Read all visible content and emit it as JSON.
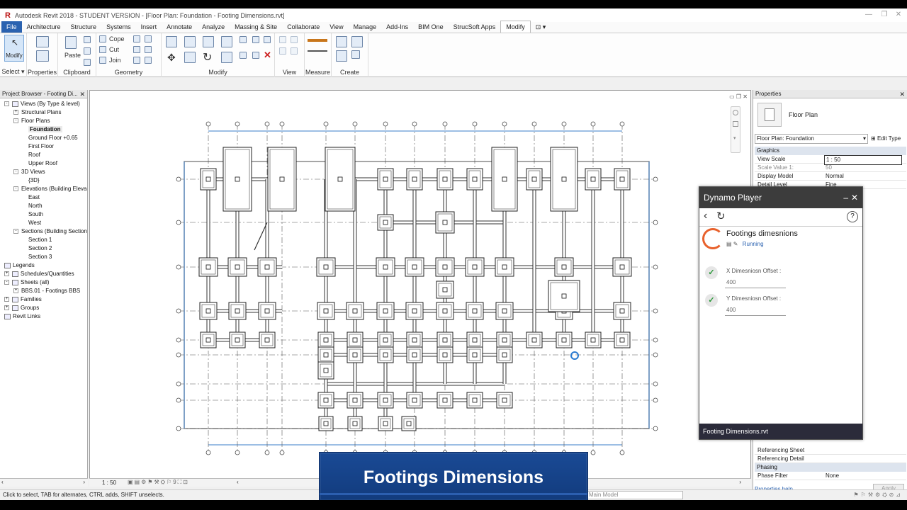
{
  "window": {
    "title": "Autodesk Revit 2018 - STUDENT VERSION - [Floor Plan: Foundation - Footing Dimensions.rvt]"
  },
  "ribbon": {
    "tabs": [
      "File",
      "Architecture",
      "Structure",
      "Systems",
      "Insert",
      "Annotate",
      "Analyze",
      "Massing & Site",
      "Collaborate",
      "View",
      "Manage",
      "Add-Ins",
      "BIM One",
      "StrucSoft Apps",
      "Modify"
    ],
    "active_tab": "Modify",
    "modify_label": "Modify",
    "panels": {
      "select": "Select",
      "properties": "Properties",
      "clipboard": "Clipboard",
      "paste": "Paste",
      "geometry": "Geometry",
      "modify": "Modify",
      "view": "View",
      "measure": "Measure",
      "create": "Create"
    },
    "geometry_items": {
      "cope": "Cope",
      "cut": "Cut",
      "join": "Join"
    }
  },
  "project_browser": {
    "title": "Project Browser - Footing Di...",
    "nodes": [
      {
        "label": "Views (By Type & level)",
        "toggle": "-",
        "level": 0,
        "icon": true
      },
      {
        "label": "Structural Plans",
        "toggle": "+",
        "level": 1
      },
      {
        "label": "Floor Plans",
        "toggle": "-",
        "level": 1
      },
      {
        "label": "Foundation",
        "level": 2,
        "selected": true
      },
      {
        "label": "Ground Floor +0.65",
        "level": 2
      },
      {
        "label": "First Floor",
        "level": 2
      },
      {
        "label": "Roof",
        "level": 2
      },
      {
        "label": "Upper Roof",
        "level": 2
      },
      {
        "label": "3D Views",
        "toggle": "-",
        "level": 1
      },
      {
        "label": "{3D}",
        "level": 2
      },
      {
        "label": "Elevations (Building Eleva",
        "toggle": "-",
        "level": 1
      },
      {
        "label": "East",
        "level": 2
      },
      {
        "label": "North",
        "level": 2
      },
      {
        "label": "South",
        "level": 2
      },
      {
        "label": "West",
        "level": 2
      },
      {
        "label": "Sections (Building Section",
        "toggle": "-",
        "level": 1
      },
      {
        "label": "Section 1",
        "level": 2
      },
      {
        "label": "Section 2",
        "level": 2
      },
      {
        "label": "Section 3",
        "level": 2
      },
      {
        "label": "Legends",
        "level": 0,
        "icon": true
      },
      {
        "label": "Schedules/Quantities",
        "toggle": "+",
        "level": 0,
        "icon": true
      },
      {
        "label": "Sheets (all)",
        "toggle": "-",
        "level": 0,
        "icon": true
      },
      {
        "label": "BBS.01 - Footings BBS",
        "toggle": "+",
        "level": 1
      },
      {
        "label": "Families",
        "toggle": "+",
        "level": 0,
        "icon": true
      },
      {
        "label": "Groups",
        "toggle": "+",
        "level": 0,
        "icon": true
      },
      {
        "label": "Revit Links",
        "level": 0,
        "icon": true
      }
    ]
  },
  "properties": {
    "title": "Properties",
    "type_name": "Floor Plan",
    "instance_selector": "Floor Plan: Foundation",
    "edit_type": "Edit Type",
    "groups": {
      "graphics": "Graphics",
      "phasing": "Phasing"
    },
    "rows": [
      {
        "k": "View Scale",
        "v": "1 : 50"
      },
      {
        "k": "Scale Value   1:",
        "v": "50"
      },
      {
        "k": "Display Model",
        "v": "Normal"
      },
      {
        "k": "Detail Level",
        "v": "Fine"
      }
    ],
    "bottom_rows": [
      {
        "k": "Referencing Sheet",
        "v": ""
      },
      {
        "k": "Referencing Detail",
        "v": ""
      }
    ],
    "phase_filter": {
      "k": "Phase Filter",
      "v": "None"
    },
    "help": "Properties help",
    "apply": "Apply"
  },
  "dynamo": {
    "title": "Dynamo Player",
    "script_name": "Footings dimesnions",
    "status": "Running",
    "inputs": [
      {
        "label": "X Dimesniosn Offset :",
        "value": "400"
      },
      {
        "label": "Y Dimesniosn Offset :",
        "value": "400"
      }
    ],
    "footer": "Footing Dimensions.rvt"
  },
  "view_control_bar": {
    "scale": "1 : 50"
  },
  "status_bar": {
    "hint": "Click to select, TAB for alternates, CTRL adds, SHIFT unselects.",
    "model": "Main Model"
  },
  "overlay_title": "Footings Dimensions",
  "colors": {
    "accent": "#2a62b0",
    "overlay": "#1a4a95",
    "dynamo_header": "#3c3c3c",
    "running": "#e8612c"
  }
}
